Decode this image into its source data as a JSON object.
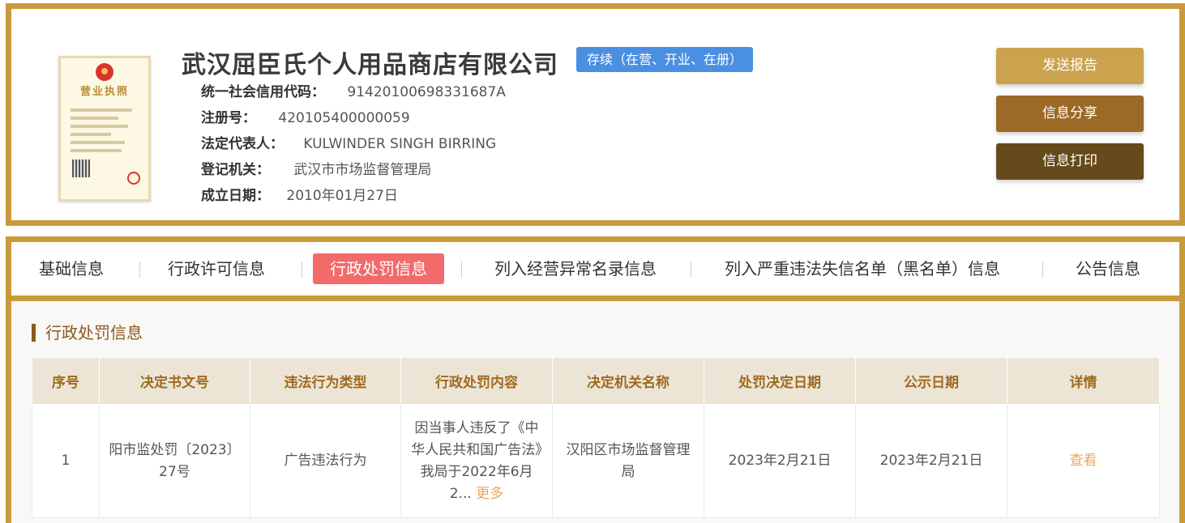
{
  "company": {
    "name": "武汉屈臣氏个人用品商店有限公司",
    "status": "存续（在营、开业、在册）",
    "license_image": {
      "title": "营业执照"
    },
    "fields": [
      {
        "label": "统一社会信用代码：",
        "value": "91420100698331687A"
      },
      {
        "label": "注册号：",
        "value": "420105400000059"
      },
      {
        "label": "法定代表人：",
        "value": "KULWINDER SINGH BIRRING"
      },
      {
        "label": "登记机关：",
        "value": "武汉市市场监督管理局"
      },
      {
        "label": "成立日期：",
        "value": "2010年01月27日"
      }
    ]
  },
  "actions": {
    "send_report": "发送报告",
    "share": "信息分享",
    "print": "信息打印"
  },
  "tabs": [
    {
      "label": "基础信息",
      "active": false
    },
    {
      "label": "行政许可信息",
      "active": false
    },
    {
      "label": "行政处罚信息",
      "active": true
    },
    {
      "label": "列入经营异常名录信息",
      "active": false
    },
    {
      "label": "列入严重违法失信名单（黑名单）信息",
      "active": false
    },
    {
      "label": "公告信息",
      "active": false
    }
  ],
  "section": {
    "title": "行政处罚信息",
    "columns": [
      "序号",
      "决定书文号",
      "违法行为类型",
      "行政处罚内容",
      "决定机关名称",
      "处罚决定日期",
      "公示日期",
      "详情"
    ],
    "rows": [
      {
        "index": "1",
        "doc_no": "阳市监处罚〔2023〕27号",
        "violation_type": "广告违法行为",
        "content": "因当事人违反了《中华人民共和国广告法》我局于2022年6月2...",
        "more": "更多",
        "authority": "汉阳区市场监督管理局",
        "decision_date": "2023年2月21日",
        "publish_date": "2023年2月21日",
        "detail": "查看"
      }
    ]
  },
  "colors": {
    "frame": "#c99a3b",
    "status_badge": "#4a90e2",
    "active_tab": "#f26a6a",
    "btn_send": "#cba24d",
    "btn_share": "#9c6a26",
    "btn_print": "#664a1c",
    "header_text": "#a06a1e",
    "link": "#e8a85d"
  }
}
